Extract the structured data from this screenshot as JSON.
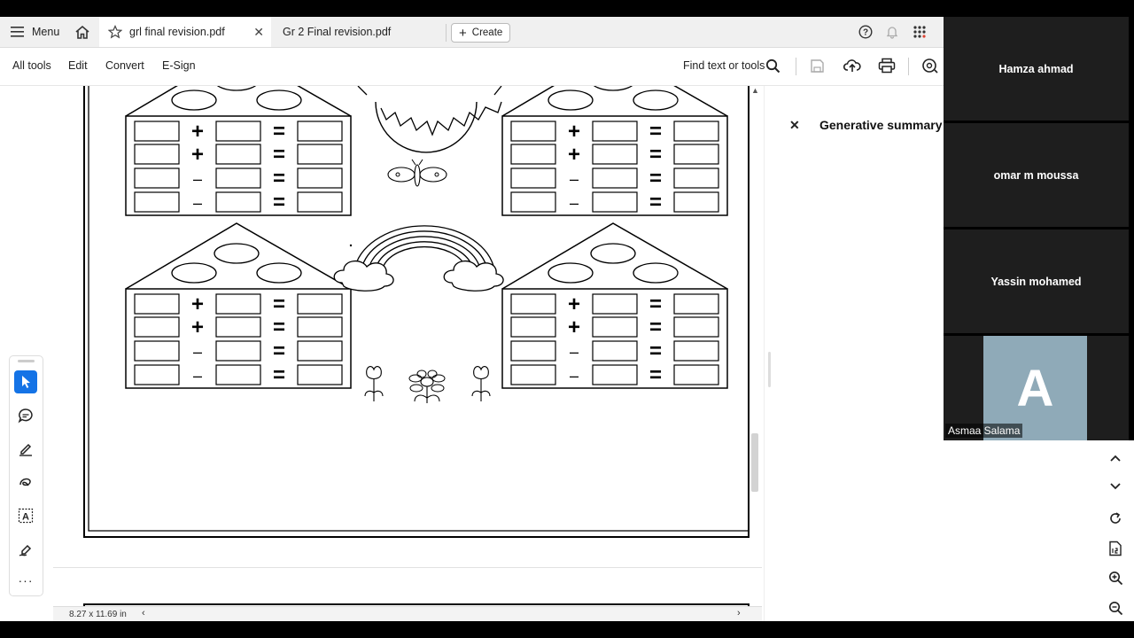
{
  "tabs": {
    "menu_label": "Menu",
    "tab1_label": "grl final revision.pdf",
    "tab2_label": "Gr 2 Final revision.pdf",
    "create_label": "Create"
  },
  "toolbar": {
    "all_tools": "All tools",
    "edit": "Edit",
    "convert": "Convert",
    "esign": "E-Sign",
    "find": "Find text or tools"
  },
  "panel": {
    "title": "Generative summary"
  },
  "status": {
    "page_size": "8.27 x 11.69 in"
  },
  "participants": [
    {
      "name": "Hamza ahmad"
    },
    {
      "name": "omar m moussa"
    },
    {
      "name": "Yassin mohamed"
    },
    {
      "name": "Asmaa Salama",
      "initial": "A"
    }
  ],
  "worksheet": {
    "plus": "+",
    "minus": "–",
    "equals": "="
  },
  "colors": {
    "accent_blue": "#1473e6",
    "tab_bg": "#f0f0f0",
    "avatar_bg": "#8faab8",
    "video_tile": "#1e1e1e"
  }
}
